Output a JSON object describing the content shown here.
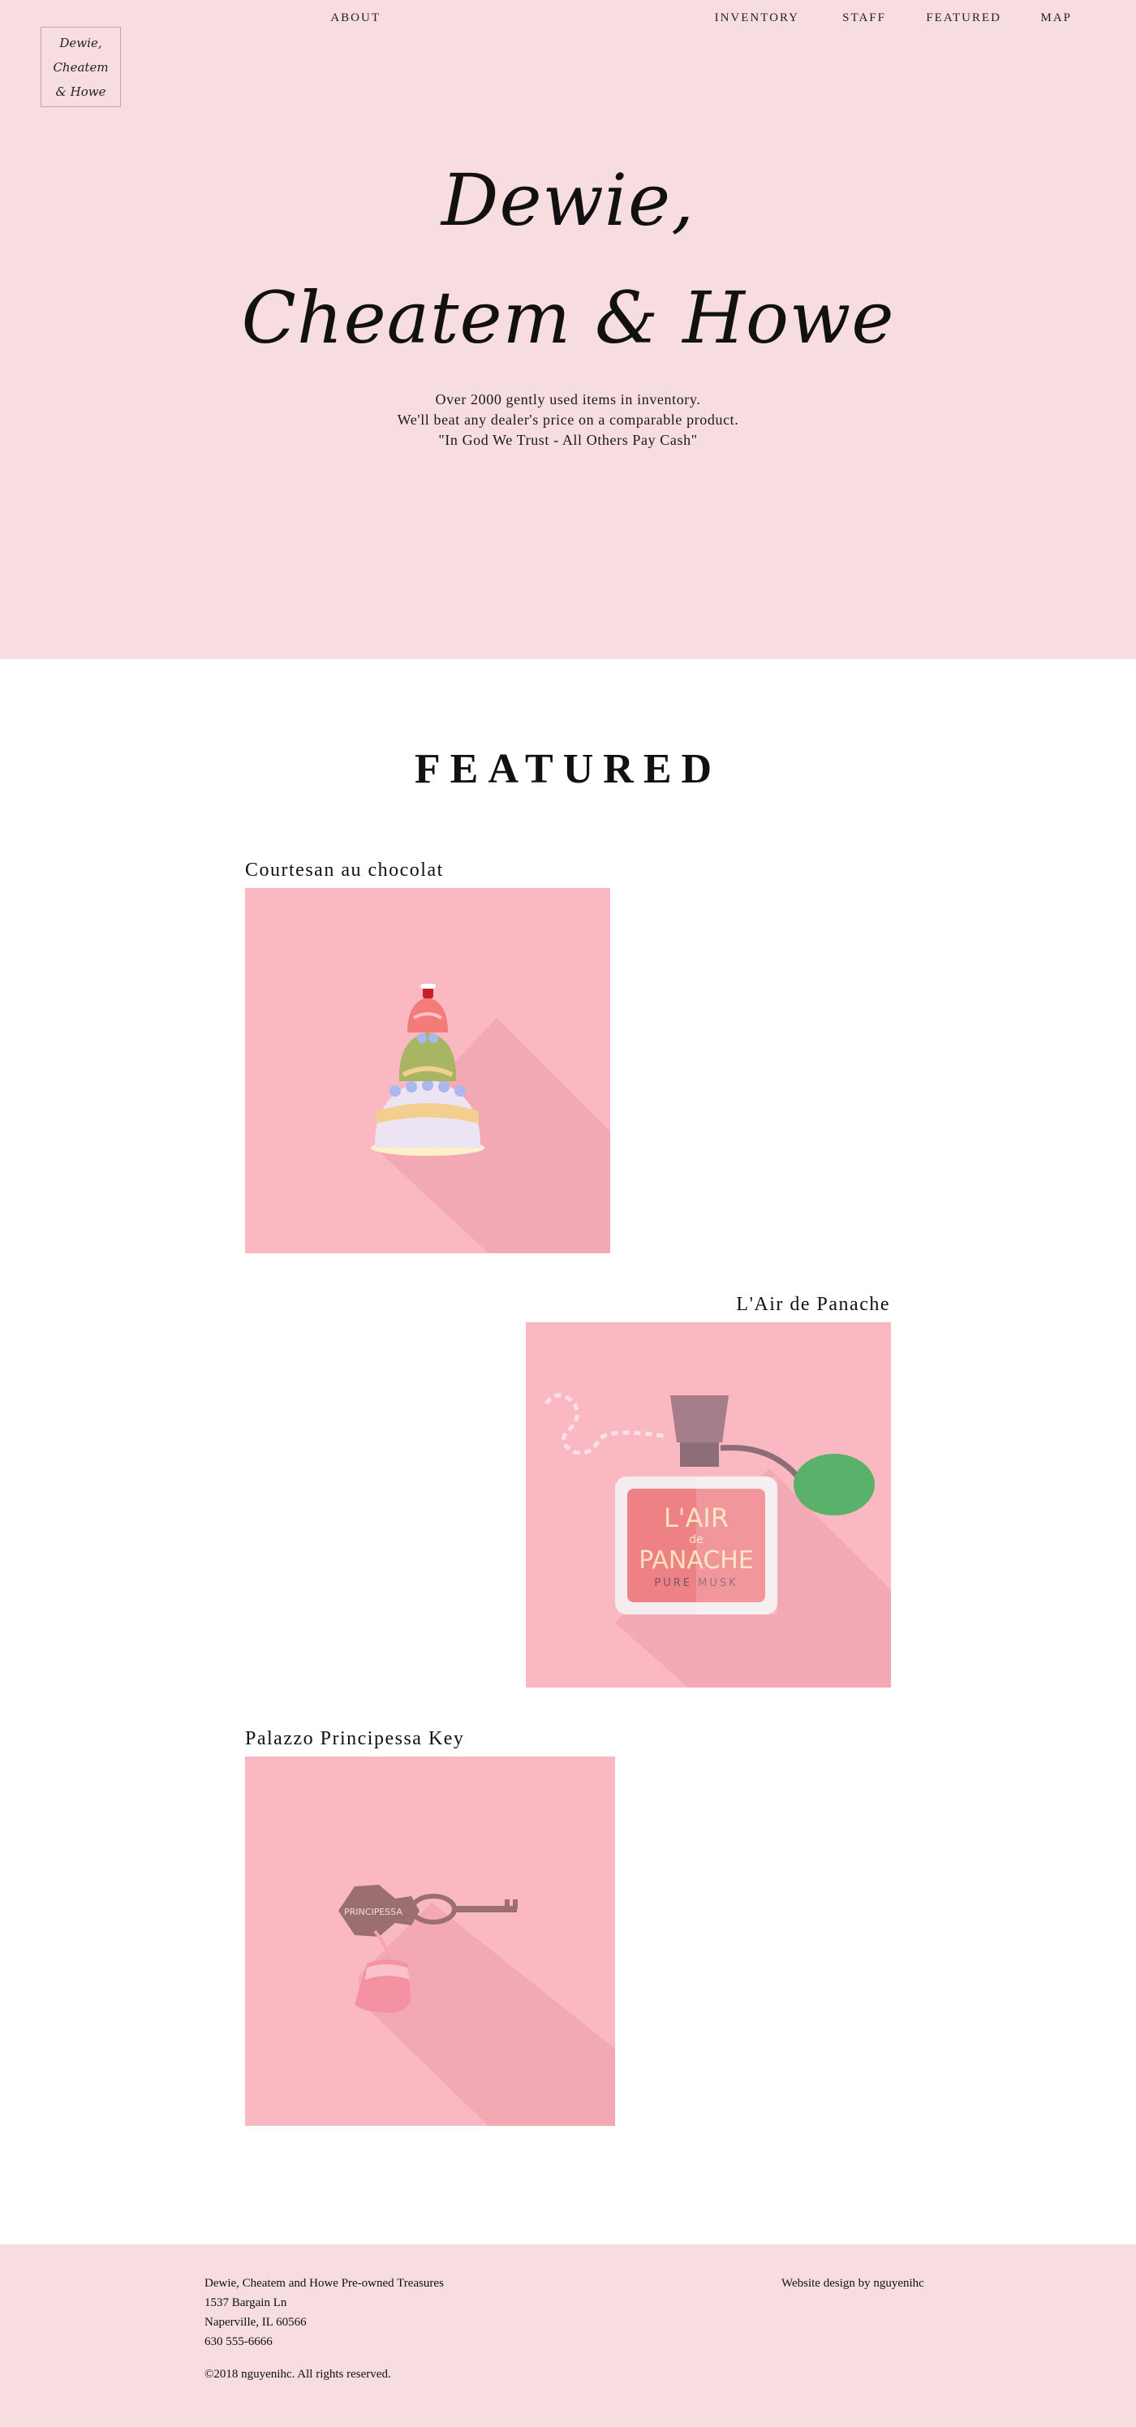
{
  "logo": {
    "lines": [
      "Dewie,",
      "Cheatem",
      "& Howe"
    ]
  },
  "nav": [
    "ABOUT",
    "INVENTORY",
    "STAFF",
    "FEATURED",
    "MAP"
  ],
  "hero": {
    "title_line1": "Dewie,",
    "title_line2": "Cheatem & Howe",
    "tagline": [
      "Over 2000 gently used items in inventory.",
      "We'll beat any dealer's price on a comparable product.",
      "\"In God We Trust - All Others Pay Cash\""
    ]
  },
  "featured": {
    "heading": "FEATURED",
    "items": [
      {
        "title": "Courtesan au chocolat"
      },
      {
        "title": "L'Air de Panache",
        "label": {
          "line1": "L'AIR",
          "line2": "de",
          "line3": "PANACHE",
          "line4": "PURE MUSK"
        }
      },
      {
        "title": "Palazzo Principessa Key",
        "label": "PRINCIPESSA"
      }
    ]
  },
  "footer": {
    "company": "Dewie, Cheatem and Howe Pre-owned Treasures",
    "street": "1537 Bargain Ln",
    "city": "Naperville, IL 60566",
    "phone": "630 555-6666",
    "copyright": "©2018 nguyenihc. All rights reserved.",
    "credit": "Website design by nguyenihc"
  },
  "colors": {
    "hero_bg": "#f7dce0",
    "card_bg": "#fab9c2",
    "text": "#111111"
  }
}
